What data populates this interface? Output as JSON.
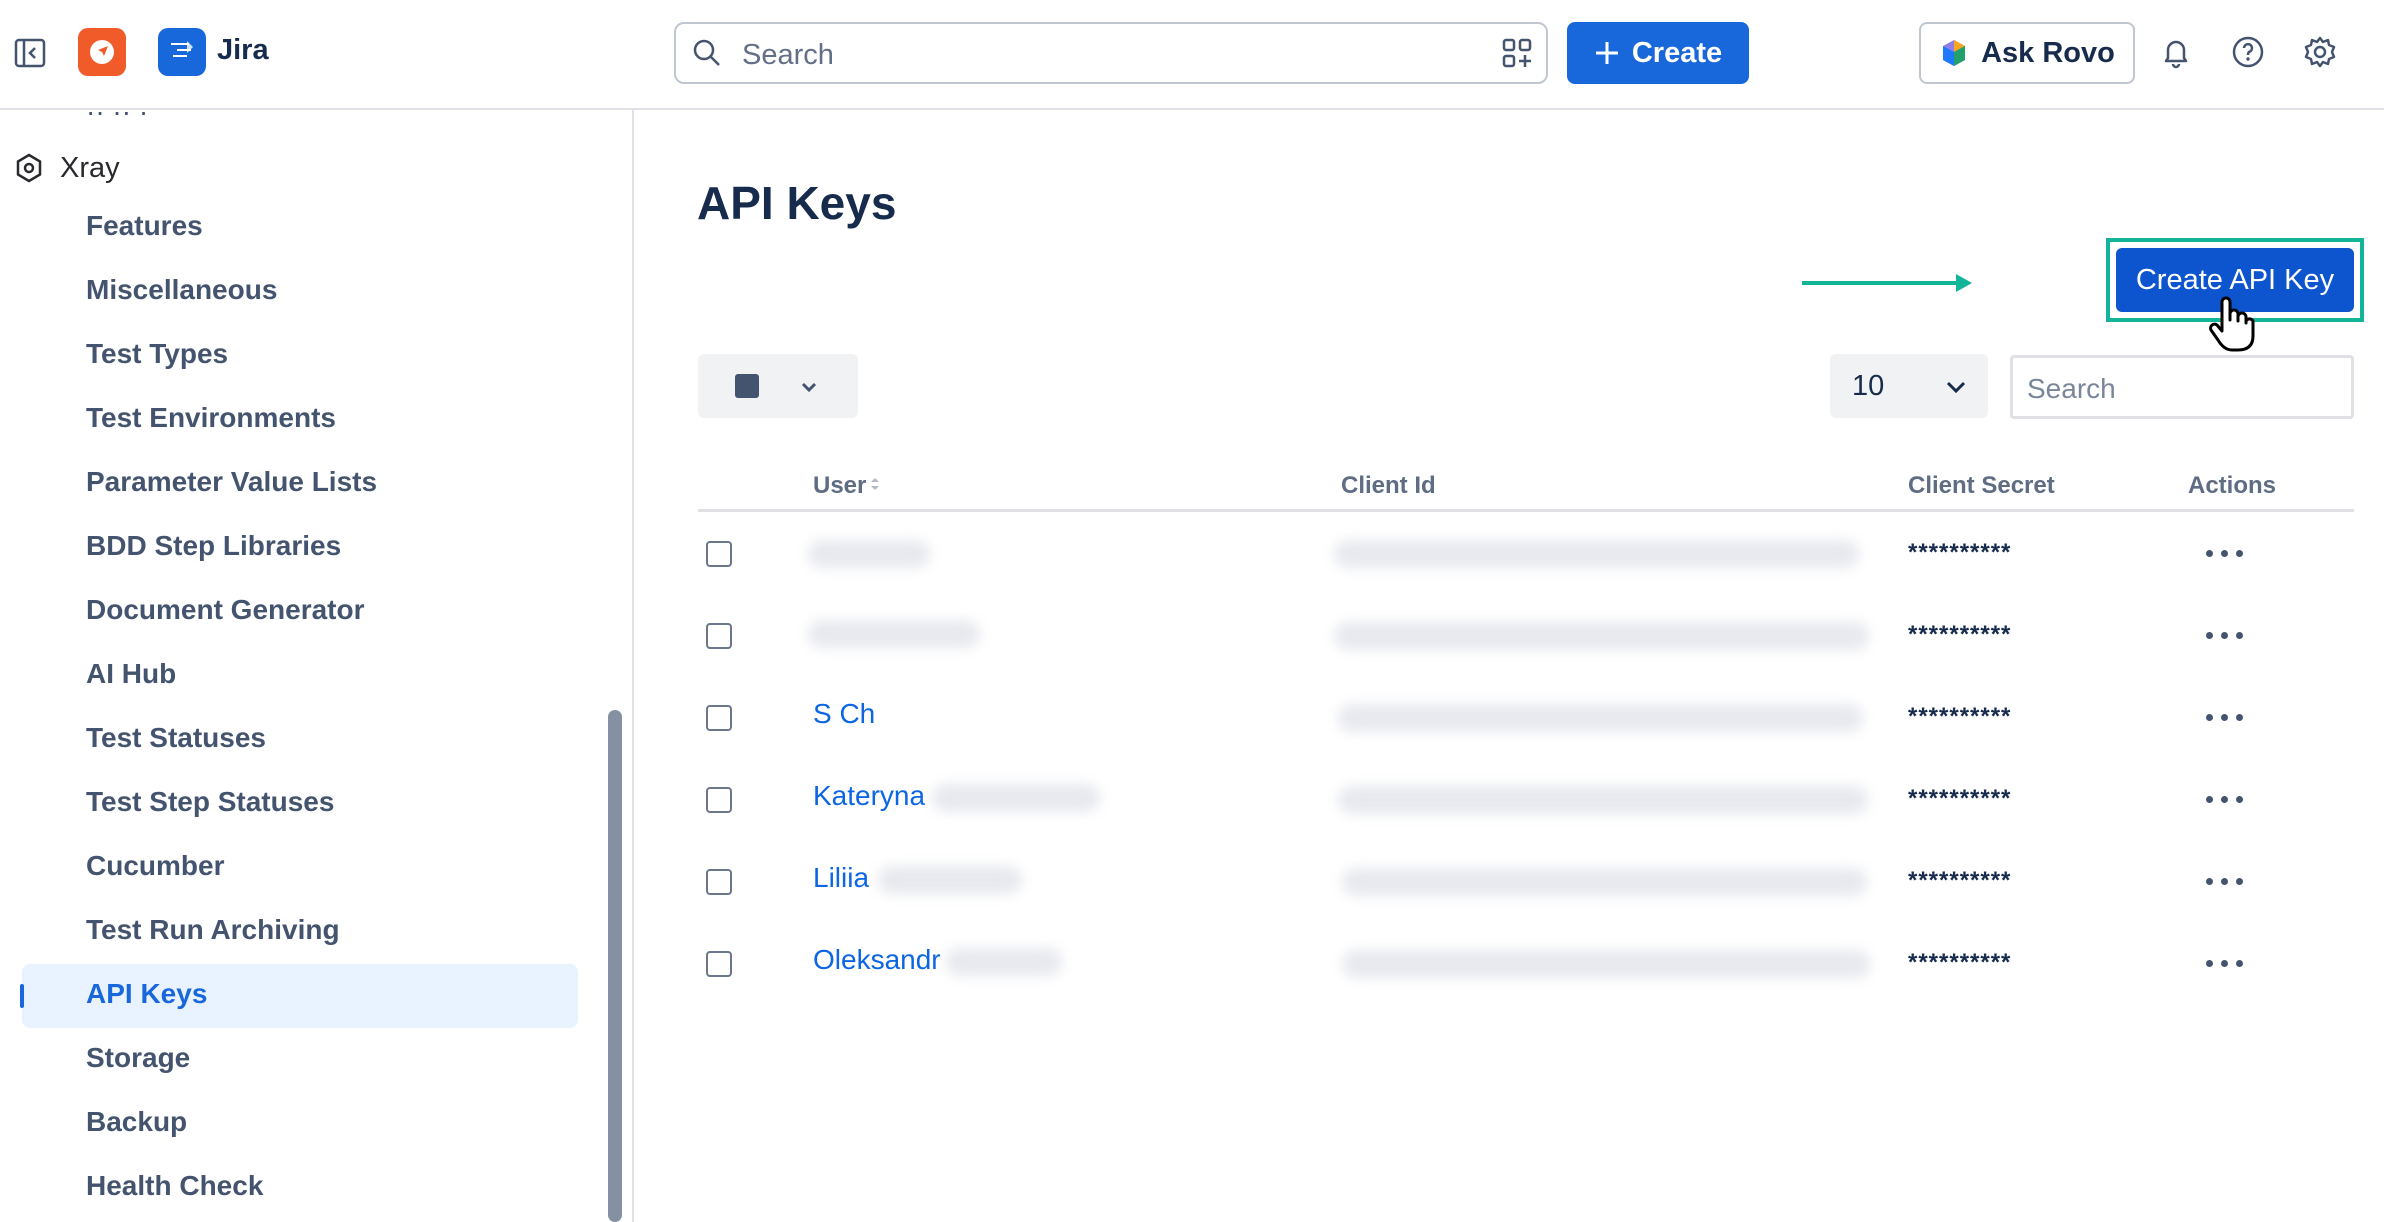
{
  "topbar": {
    "app_name": "Jira",
    "search_placeholder": "Search",
    "create_label": "Create",
    "ask_rovo_label": "Ask Rovo"
  },
  "sidebar": {
    "section_title": "Xray",
    "items": [
      "Features",
      "Miscellaneous",
      "Test Types",
      "Test Environments",
      "Parameter Value Lists",
      "BDD Step Libraries",
      "Document Generator",
      "AI Hub",
      "Test Statuses",
      "Test Step Statuses",
      "Cucumber",
      "Test Run Archiving",
      "API Keys",
      "Storage",
      "Backup",
      "Health Check"
    ],
    "active_item": "API Keys"
  },
  "main": {
    "title": "API Keys",
    "create_button_label": "Create API Key",
    "page_size": "10",
    "table_search_placeholder": "Search",
    "columns": {
      "user": "User",
      "client_id": "Client Id",
      "client_secret": "Client Secret",
      "actions": "Actions"
    },
    "rows": [
      {
        "user": "",
        "secret": "**********"
      },
      {
        "user": "",
        "secret": "**********"
      },
      {
        "user": "S Ch",
        "secret": "**********"
      },
      {
        "user": "Kateryna",
        "secret": "**********"
      },
      {
        "user": "Liliia",
        "secret": "**********"
      },
      {
        "user": "Oleksandr",
        "secret": "**********"
      }
    ]
  },
  "colors": {
    "brand": "#1868db",
    "highlight": "#12b59a",
    "active_bg": "#e9f2ff"
  }
}
